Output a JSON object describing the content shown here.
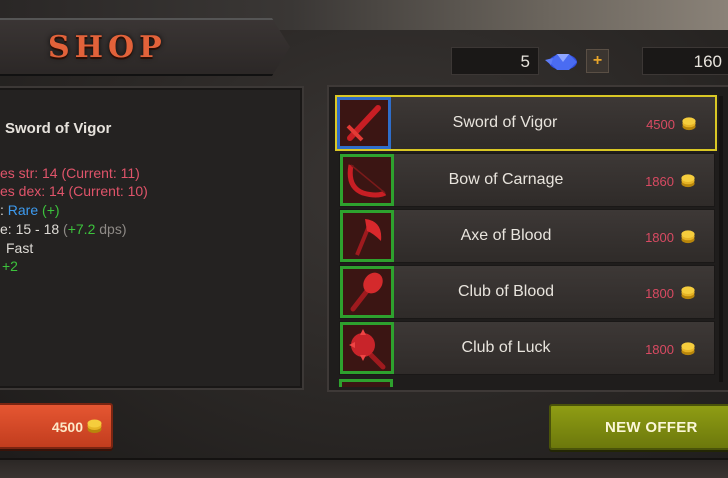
{
  "header": {
    "title": "SHOP",
    "gems": "5",
    "gem_add_label": "+",
    "gold": "160"
  },
  "details": {
    "item_name": "Sword of Vigor",
    "req_str_text": "es str: 14 (Current: 11)",
    "req_dex_text": "es dex: 14 (Current: 10)",
    "rarity_prefix": ":",
    "rarity_value": "Rare",
    "rarity_bonus": "(+)",
    "damage_prefix": "e: 15 - 18",
    "damage_bonus_open": "(",
    "damage_bonus_value": "+7.2",
    "damage_bonus_unit": "dps)",
    "speed_value": "Fast",
    "extra_bonus": "+2"
  },
  "buy": {
    "price": "4500"
  },
  "items": [
    {
      "name": "Sword of Vigor",
      "price": "4500",
      "icon": "sword-icon",
      "selected": true
    },
    {
      "name": "Bow of Carnage",
      "price": "1860",
      "icon": "bow-icon",
      "selected": false
    },
    {
      "name": "Axe of Blood",
      "price": "1800",
      "icon": "axe-icon",
      "selected": false
    },
    {
      "name": "Club of Blood",
      "price": "1800",
      "icon": "club-icon",
      "selected": false
    },
    {
      "name": "Club of Luck",
      "price": "1800",
      "icon": "spiked-club-icon",
      "selected": false
    }
  ],
  "actions": {
    "new_offer_label": "NEW OFFER"
  },
  "colors": {
    "title": "#e2623a",
    "requirement": "#e0546a",
    "rare": "#3d9bf0",
    "bonus": "#3cc33c",
    "selected_border": "#d9c725",
    "buy_button": "#d44a28",
    "offer_button": "#7f8c12"
  }
}
